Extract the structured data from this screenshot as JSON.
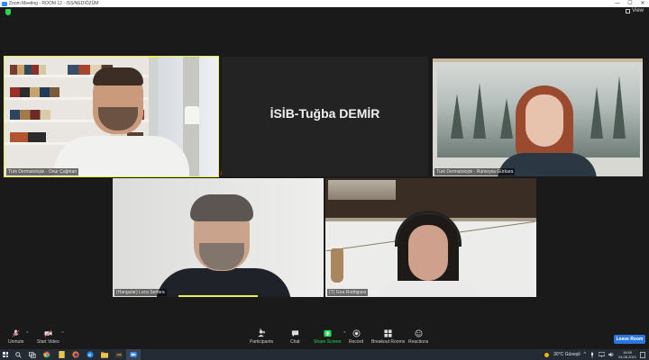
{
  "window": {
    "title": "Zoom Meeting - ROOM 12 - ISS/NEDIÖZÜM",
    "view_label": "View",
    "minimize": "—",
    "maximize": "☐",
    "close": "✕"
  },
  "tiles": [
    {
      "name": "Türk Dermatolojisi - Onur Çağman"
    },
    {
      "name": "",
      "display_name": "İSİB-Tuğba DEMİR"
    },
    {
      "name": "Türk Dermatolojisi - Rümeysa Gürkara"
    },
    {
      "name": "(Hangular) Luca Serfara"
    },
    {
      "name": "(T) Gna Rodriguez"
    }
  ],
  "toolbar": {
    "unmute": "Unmute",
    "start_video": "Start Video",
    "participants": "Participants",
    "participants_count": "5",
    "chat": "Chat",
    "share_screen": "Share Screen",
    "record": "Record",
    "breakout_rooms": "Breakout Rooms",
    "reactions": "Reactions",
    "leave": "Leave Room"
  },
  "taskbar": {
    "weather": "30°C Güneşli",
    "time": "16:59",
    "date": "24.08.2021"
  },
  "colors": {
    "speaker_highlight": "#e8f044",
    "share_green": "#23d959",
    "leave_blue": "#2d75e0"
  }
}
